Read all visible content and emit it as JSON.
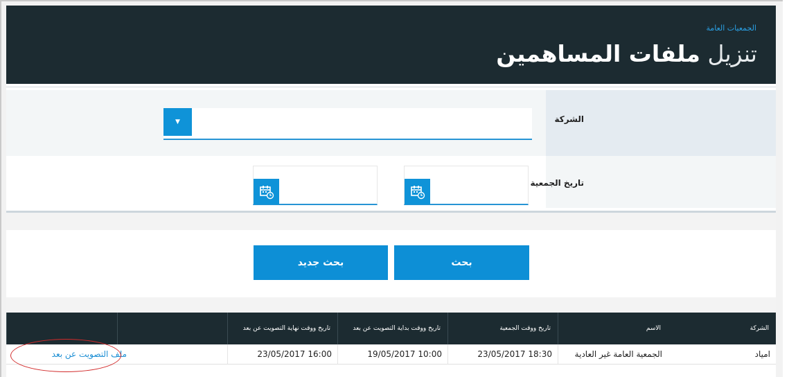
{
  "header": {
    "breadcrumb": "الجمعيات العامة",
    "title_light": "تنزيل",
    "title_bold": "ملفات المساهمين"
  },
  "filters": {
    "company_label": "الشركة",
    "company_value": "",
    "date_label": "تاريخ الجمعية",
    "date_from": "",
    "date_to": ""
  },
  "buttons": {
    "search": "بحث",
    "new_search": "بحث جديد"
  },
  "table": {
    "headers": [
      "الشركة",
      "الاسم",
      "تاريخ ووقت الجمعية",
      "تاريخ ووقت بداية التصويت عن بعد",
      "تاريخ ووقت نهاية التصويت عن بعد",
      ""
    ],
    "rows": [
      [
        "امياد",
        "الجمعية العامة غير العادية",
        "18:30 23/05/2017",
        "10:00 19/05/2017",
        "16:00 23/05/2017",
        "ملف التصويت عن بعد"
      ]
    ]
  },
  "colors": {
    "header_bg": "#1c2b31",
    "accent": "#0d8fd6",
    "link": "#1b8ed4",
    "annotation": "#d22b2b"
  },
  "icons": {
    "dropdown": "caret-down-icon",
    "date": "calendar-clock-icon"
  }
}
